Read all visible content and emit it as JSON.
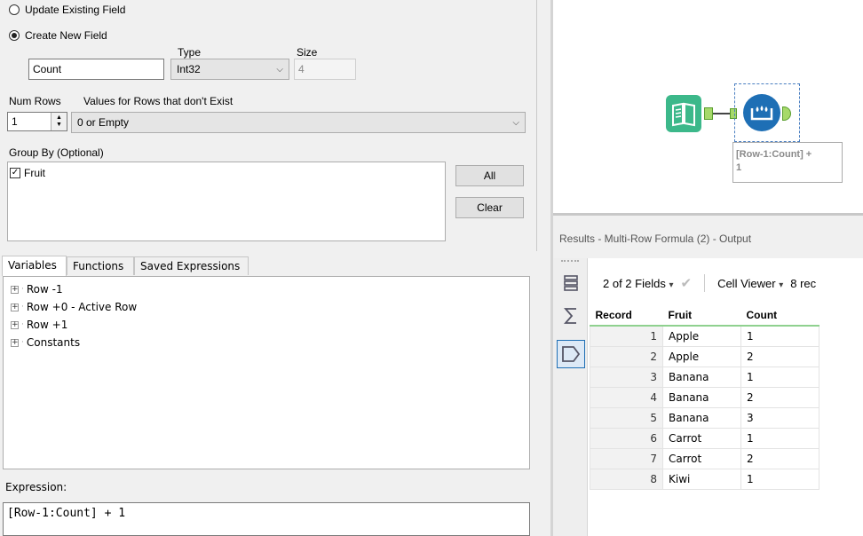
{
  "config": {
    "update_existing_label": "Update Existing Field",
    "create_new_label": "Create New  Field",
    "type_label": "Type",
    "size_label": "Size",
    "field_name": "Count",
    "type_value": "Int32",
    "size_value": "4",
    "num_rows_label": "Num Rows",
    "values_label": "Values for Rows that don't Exist",
    "num_rows_value": "1",
    "values_select": "0 or Empty",
    "group_by_label": "Group By (Optional)",
    "group_by_items": [
      {
        "label": "Fruit",
        "checked": true
      }
    ],
    "all_button": "All",
    "clear_button": "Clear"
  },
  "tabs": [
    "Variables",
    "Functions",
    "Saved Expressions"
  ],
  "tree": [
    "Row -1",
    "Row +0 - Active Row",
    "Row +1",
    "Constants"
  ],
  "expression": {
    "label": "Expression:",
    "value": "[Row-1:Count] + 1"
  },
  "canvas": {
    "tool_annotation_line1": "[Row-1:Count] +",
    "tool_annotation_line2": "1",
    "input_tool_icon": "book-input-icon",
    "formula_tool_icon": "multi-row-formula-icon",
    "accent_green": "#3cb88a",
    "accent_blue": "#1e6fb5"
  },
  "results": {
    "title": "Results - Multi-Row Formula (2) - Output",
    "fields_label": "2 of 2 Fields",
    "cell_viewer_label": "Cell Viewer",
    "records_label": "8 rec",
    "columns": [
      "Record",
      "Fruit",
      "Count"
    ],
    "rows": [
      [
        "1",
        "Apple",
        "1"
      ],
      [
        "2",
        "Apple",
        "2"
      ],
      [
        "3",
        "Banana",
        "1"
      ],
      [
        "4",
        "Banana",
        "2"
      ],
      [
        "5",
        "Banana",
        "3"
      ],
      [
        "6",
        "Carrot",
        "1"
      ],
      [
        "7",
        "Carrot",
        "2"
      ],
      [
        "8",
        "Kiwi",
        "1"
      ]
    ]
  }
}
